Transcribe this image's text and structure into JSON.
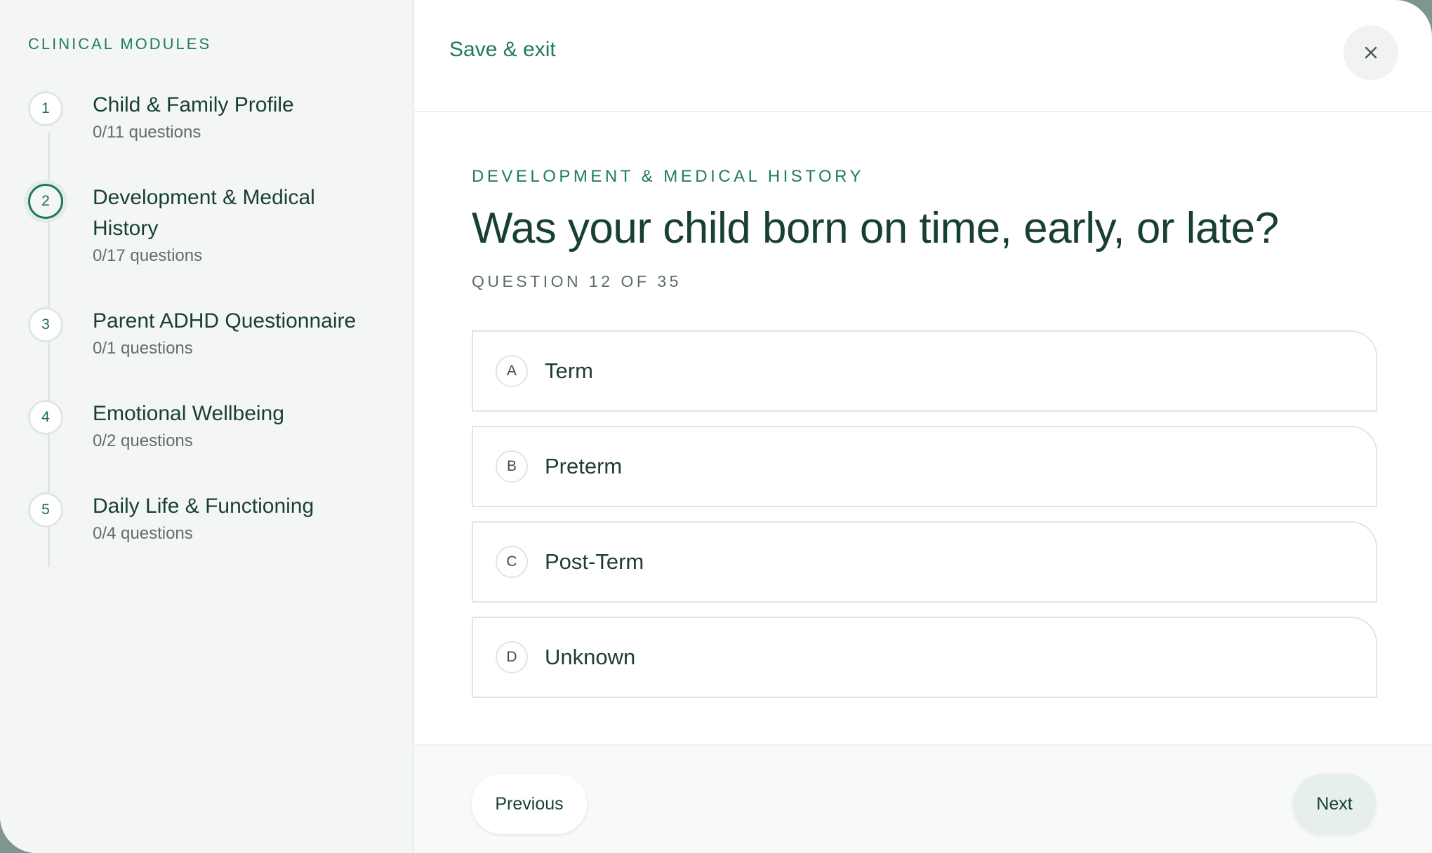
{
  "sidebar": {
    "title": "CLINICAL MODULES",
    "modules": [
      {
        "number": "1",
        "title": "Child & Family Profile",
        "progress": "0/11 questions"
      },
      {
        "number": "2",
        "title": "Development & Medical History",
        "progress": "0/17 questions",
        "active": true
      },
      {
        "number": "3",
        "title": "Parent ADHD Questionnaire",
        "progress": "0/1 questions"
      },
      {
        "number": "4",
        "title": "Emotional Wellbeing",
        "progress": "0/2 questions"
      },
      {
        "number": "5",
        "title": "Daily Life & Functioning",
        "progress": "0/4 questions"
      }
    ]
  },
  "header": {
    "save_exit": "Save & exit",
    "close_icon": "close-icon"
  },
  "question": {
    "section": "DEVELOPMENT & MEDICAL HISTORY",
    "text": "Was your child born on time, early, or late?",
    "counter": "QUESTION 12 OF 35",
    "options": [
      {
        "letter": "A",
        "label": "Term"
      },
      {
        "letter": "B",
        "label": "Preterm"
      },
      {
        "letter": "C",
        "label": "Post-Term"
      },
      {
        "letter": "D",
        "label": "Unknown"
      }
    ]
  },
  "footer": {
    "previous": "Previous",
    "next": "Next"
  },
  "colors": {
    "accent": "#1f7a5e",
    "text_dark": "#183f33",
    "sidebar_bg": "#f4f6f5"
  }
}
